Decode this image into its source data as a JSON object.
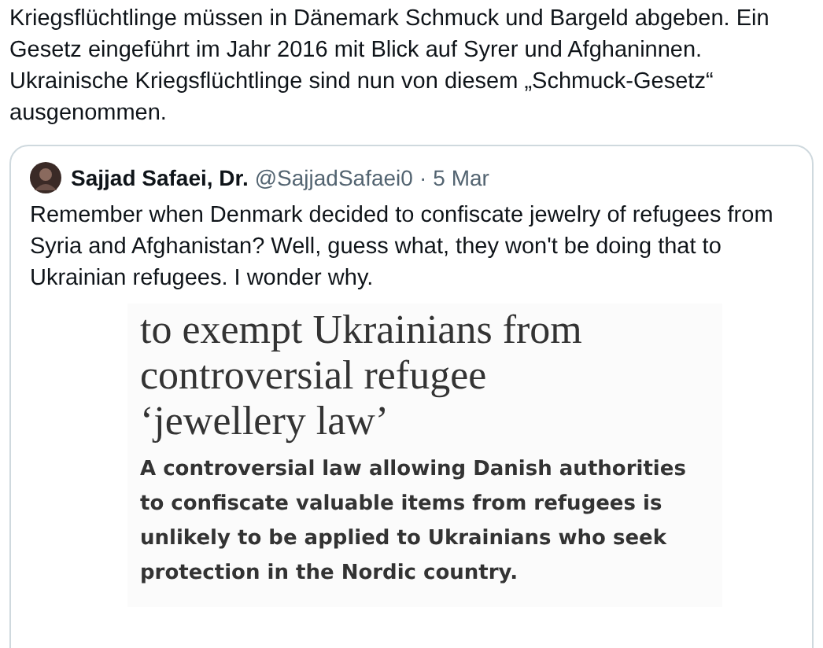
{
  "tweet": {
    "text": "Kriegsflüchtlinge müssen in Dänemark Schmuck und Bargeld abgeben. Ein Gesetz eingeführt im Jahr 2016 mit Blick auf Syrer und Afghaninnen. Ukrainische Kriegsflüchtlinge sind nun von diesem „Schmuck-Gesetz“ ausgenommen."
  },
  "quoted_tweet": {
    "author": "Sajjad Safaei, Dr.",
    "handle": "@SajjadSafaei0",
    "separator": "·",
    "date": "5 Mar",
    "text": "Remember when Denmark decided to confiscate jewelry of refugees from Syria and Afghanistan? Well, guess what, they won't be doing that to Ukrainian refugees. I wonder why.",
    "article": {
      "headline": [
        "to exempt Ukrainians from",
        "controversial refugee",
        "‘jewellery law’"
      ],
      "summary": "A controversial law allowing Danish authorities to confiscate valuable items from refugees is unlikely to be applied to Ukrainians who seek protection in the Nordic country."
    }
  }
}
